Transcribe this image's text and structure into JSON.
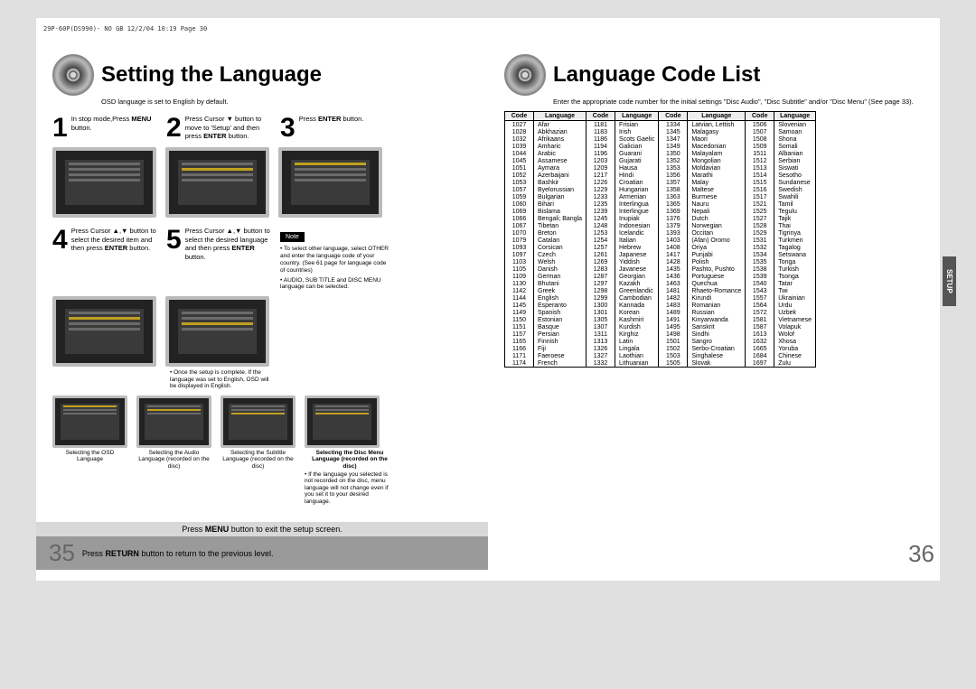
{
  "header": "29P-60P(DS990)- NO GB  12/2/04 10:19  Page 30",
  "left": {
    "title": "Setting the Language",
    "sub": "OSD language is set to English by default.",
    "steps": [
      {
        "n": "1",
        "text_html": "In stop mode,Press <b>MENU</b> button."
      },
      {
        "n": "2",
        "text_html": "Press Cursor ▼ button to move to 'Setup' and then press <b>ENTER</b> button."
      },
      {
        "n": "3",
        "text_html": "Press <b>ENTER</b> button."
      },
      {
        "n": "4",
        "text_html": "Press Cursor ▲,▼ button to select the desired item and then press <b>ENTER</b> button."
      },
      {
        "n": "5",
        "text_html": "Press Cursor ▲,▼ button to select the desired language and then press <b>ENTER</b> button."
      }
    ],
    "note_label": "Note",
    "note_bullets": [
      "To select other language, select OTHER and enter the language code of your country. (See 61 page for language code of countries)",
      "AUDIO, SUB TITLE and DISC MENU language can be selected."
    ],
    "step5_caption": "• Once the setup is complete. If the language was set to English, OSD will be displayed in English.",
    "tv_captions": [
      "Selecting the OSD Language",
      "Selecting the Audio Language (recorded on the disc)",
      "Selecting the Subtitle Language (recorded on the disc)"
    ],
    "disc_menu_caption_title": "Selecting the Disc Menu Language (recorded on the disc)",
    "disc_menu_caption_note": "• If the language you selected is not recorded on the disc, menu language will not change even if you set it to your desired language.",
    "bottom_line1": "Press MENU button to exit the setup screen.",
    "bottom_line2": "Press RETURN button to return to the previous level.",
    "page_num": "35"
  },
  "right": {
    "title": "Language Code List",
    "sub": "Enter the appropriate code number for the initial settings \"Disc Audio\", \"Disc Subtitle\" and/or \"Disc Menu\" (See page 33).",
    "setup_tab": "SETUP",
    "page_num": "36",
    "headers": [
      "Code",
      "Language",
      "Code",
      "Language",
      "Code",
      "Language",
      "Code",
      "Language"
    ],
    "rows": [
      [
        "1027",
        "Afar",
        "1181",
        "Frisian",
        "1334",
        "Latvian, Lettish",
        "1506",
        "Slovenian"
      ],
      [
        "1028",
        "Abkhazian",
        "1183",
        "Irish",
        "1345",
        "Malagasy",
        "1507",
        "Samoan"
      ],
      [
        "1032",
        "Afrikaans",
        "1186",
        "Scots Gaelic",
        "1347",
        "Maori",
        "1508",
        "Shona"
      ],
      [
        "1039",
        "Amharic",
        "1194",
        "Galician",
        "1349",
        "Macedonian",
        "1509",
        "Somali"
      ],
      [
        "1044",
        "Arabic",
        "1196",
        "Guarani",
        "1350",
        "Malayalam",
        "1511",
        "Albanian"
      ],
      [
        "1045",
        "Assamese",
        "1203",
        "Gujarati",
        "1352",
        "Mongolian",
        "1512",
        "Serbian"
      ],
      [
        "1051",
        "Aymara",
        "1209",
        "Hausa",
        "1353",
        "Moldavian",
        "1513",
        "Siswati"
      ],
      [
        "1052",
        "Azerbaijani",
        "1217",
        "Hindi",
        "1356",
        "Marathi",
        "1514",
        "Sesotho"
      ],
      [
        "1053",
        "Bashkir",
        "1226",
        "Croatian",
        "1357",
        "Malay",
        "1515",
        "Sundanese"
      ],
      [
        "1057",
        "Byelorussian",
        "1229",
        "Hungarian",
        "1358",
        "Maltese",
        "1516",
        "Swedish"
      ],
      [
        "1059",
        "Bulgarian",
        "1233",
        "Armenian",
        "1363",
        "Burmese",
        "1517",
        "Swahili"
      ],
      [
        "1060",
        "Bihari",
        "1235",
        "Interlingua",
        "1365",
        "Nauru",
        "1521",
        "Tamil"
      ],
      [
        "1069",
        "Bislama",
        "1239",
        "Interlingue",
        "1369",
        "Nepali",
        "1525",
        "Tegulu"
      ],
      [
        "1066",
        "Bengali; Bangla",
        "1245",
        "Inupiak",
        "1376",
        "Dutch",
        "1527",
        "Tajik"
      ],
      [
        "1067",
        "Tibetan",
        "1248",
        "Indonesian",
        "1379",
        "Norwegian",
        "1528",
        "Thai"
      ],
      [
        "1070",
        "Breton",
        "1253",
        "Icelandic",
        "1393",
        "Occitan",
        "1529",
        "Tigrinya"
      ],
      [
        "1079",
        "Catalan",
        "1254",
        "Italian",
        "1403",
        "(Afan) Oromo",
        "1531",
        "Turkmen"
      ],
      [
        "1093",
        "Corsican",
        "1257",
        "Hebrew",
        "1408",
        "Oriya",
        "1532",
        "Tagalog"
      ],
      [
        "1097",
        "Czech",
        "1261",
        "Japanese",
        "1417",
        "Punjabi",
        "1534",
        "Setswana"
      ],
      [
        "1103",
        "Welsh",
        "1269",
        "Yiddish",
        "1428",
        "Polish",
        "1535",
        "Tonga"
      ],
      [
        "1105",
        "Danish",
        "1283",
        "Javanese",
        "1435",
        "Pashto, Pushto",
        "1538",
        "Turkish"
      ],
      [
        "1109",
        "German",
        "1287",
        "Georgian",
        "1436",
        "Portuguese",
        "1539",
        "Tsonga"
      ],
      [
        "1130",
        "Bhutani",
        "1297",
        "Kazakh",
        "1463",
        "Quechua",
        "1540",
        "Tatar"
      ],
      [
        "1142",
        "Greek",
        "1298",
        "Greenlandic",
        "1481",
        "Rhaeto-Romance",
        "1543",
        "Twi"
      ],
      [
        "1144",
        "English",
        "1299",
        "Cambodian",
        "1482",
        "Kirundi",
        "1557",
        "Ukrainian"
      ],
      [
        "1145",
        "Esperanto",
        "1300",
        "Kannada",
        "1483",
        "Romanian",
        "1564",
        "Urdu"
      ],
      [
        "1149",
        "Spanish",
        "1301",
        "Korean",
        "1489",
        "Russian",
        "1572",
        "Uzbek"
      ],
      [
        "1150",
        "Estonian",
        "1305",
        "Kashmiri",
        "1491",
        "Kinyarwanda",
        "1581",
        "Vietnamese"
      ],
      [
        "1151",
        "Basque",
        "1307",
        "Kurdish",
        "1495",
        "Sanskrit",
        "1587",
        "Volapuk"
      ],
      [
        "1157",
        "Persian",
        "1311",
        "Kirghiz",
        "1498",
        "Sindhi",
        "1613",
        "Wolof"
      ],
      [
        "1165",
        "Finnish",
        "1313",
        "Latin",
        "1501",
        "Sangro",
        "1632",
        "Xhosa"
      ],
      [
        "1166",
        "Fiji",
        "1326",
        "Lingala",
        "1502",
        "Serbo-Croatian",
        "1665",
        "Yoruba"
      ],
      [
        "1171",
        "Faeroese",
        "1327",
        "Laothian",
        "1503",
        "Singhalese",
        "1684",
        "Chinese"
      ],
      [
        "1174",
        "French",
        "1332",
        "Lithuanian",
        "1505",
        "Slovak",
        "1697",
        "Zulu"
      ]
    ]
  }
}
